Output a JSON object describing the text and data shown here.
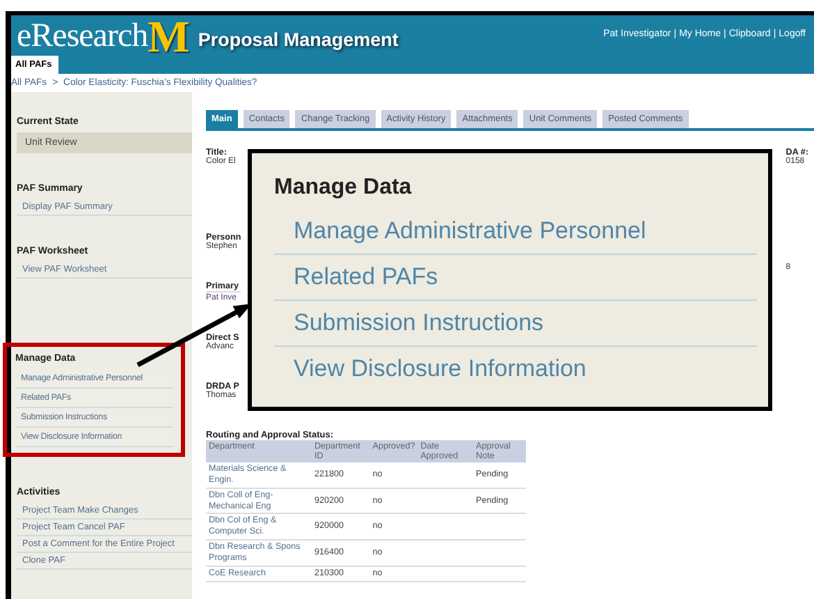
{
  "header": {
    "logo_text": "eResearch",
    "logo_mark": "M",
    "app_title": "Proposal Management",
    "user_links": [
      "Pat Investigator",
      "My Home",
      "Clipboard",
      "Logoff"
    ],
    "separator": "|",
    "tabs": [
      {
        "label": "All PAFs",
        "selected": true
      }
    ]
  },
  "breadcrumb": {
    "items": [
      "All PAFs",
      "Color Elasticity: Fuschia's Flexibility Qualities?"
    ],
    "separator": ">"
  },
  "sidebar": [
    {
      "heading": "Current State",
      "highlighted": false,
      "items": [
        {
          "kind": "state",
          "label": "Unit Review"
        }
      ]
    },
    {
      "heading": "PAF Summary",
      "highlighted": false,
      "items": [
        {
          "kind": "link",
          "label": "Display PAF Summary"
        }
      ]
    },
    {
      "heading": "PAF Worksheet",
      "highlighted": false,
      "items": [
        {
          "kind": "link",
          "label": "View PAF Worksheet"
        }
      ]
    },
    {
      "heading": "Manage Data",
      "highlighted": true,
      "items": [
        {
          "kind": "link",
          "label": "Manage Administrative Personnel"
        },
        {
          "kind": "link",
          "label": "Related PAFs"
        },
        {
          "kind": "link",
          "label": "Submission Instructions"
        },
        {
          "kind": "link",
          "label": "View Disclosure Information"
        }
      ]
    },
    {
      "heading": "Activities",
      "highlighted": false,
      "items": [
        {
          "kind": "link",
          "label": "Project Team Make Changes"
        },
        {
          "kind": "link",
          "label": "Project Team Cancel PAF"
        },
        {
          "kind": "link",
          "label": "Post a Comment for the Entire Project"
        },
        {
          "kind": "link",
          "label": "Clone PAF"
        }
      ]
    }
  ],
  "main_tabs": [
    {
      "label": "Main",
      "selected": true
    },
    {
      "label": "Contacts",
      "selected": false
    },
    {
      "label": "Change Tracking",
      "selected": false
    },
    {
      "label": "Activity History",
      "selected": false
    },
    {
      "label": "Attachments",
      "selected": false
    },
    {
      "label": "Unit Comments",
      "selected": false
    },
    {
      "label": "Posted Comments",
      "selected": false
    }
  ],
  "fields": [
    {
      "label": "Title:",
      "value": "Color El",
      "kind": "text"
    },
    {
      "label": "Personn",
      "value": "Stephen",
      "kind": "text"
    },
    {
      "label": "Primary",
      "value": "Pat Inve",
      "kind": "link"
    },
    {
      "label": "Direct S",
      "value": "Advanc",
      "kind": "text"
    },
    {
      "label": "DRDA P",
      "value": "Thomas",
      "kind": "text"
    }
  ],
  "right_fields": [
    {
      "label": "DA #:",
      "value": "0158"
    },
    {
      "value": "8"
    }
  ],
  "routing": {
    "title": "Routing and Approval Status:",
    "columns": [
      "Department",
      "Department ID",
      "Approved?",
      "Date Approved",
      "Approval Note"
    ],
    "rows": [
      [
        "Materials Science & Engin.",
        "221800",
        "no",
        "",
        "Pending"
      ],
      [
        "Dbn Coll of Eng-Mechanical Eng",
        "920200",
        "no",
        "",
        "Pending"
      ],
      [
        "Dbn Col of Eng & Computer Sci.",
        "920000",
        "no",
        "",
        ""
      ],
      [
        "Dbn Research & Spons Programs",
        "916400",
        "no",
        "",
        ""
      ],
      [
        "CoE Research",
        "210300",
        "no",
        "",
        ""
      ]
    ]
  },
  "callout": {
    "heading": "Manage Data",
    "items": [
      "Manage Administrative Personnel",
      "Related PAFs",
      "Submission Instructions",
      "View Disclosure Information"
    ]
  }
}
